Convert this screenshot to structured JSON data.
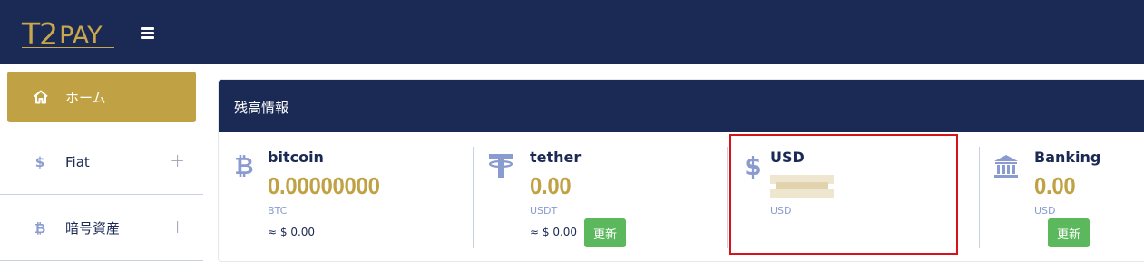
{
  "header": {
    "logo_t2": "T2",
    "logo_pay": "PAY",
    "menu_icon": "hamburger-menu-icon"
  },
  "sidebar": {
    "items": [
      {
        "label": "ホーム",
        "icon": "home-icon",
        "active": true
      },
      {
        "label": "Fiat",
        "icon": "dollar-icon",
        "expand": "+"
      },
      {
        "label": "暗号資産",
        "icon": "bitcoin-icon",
        "expand": "+"
      }
    ]
  },
  "panel": {
    "title": "残高情報",
    "cards": [
      {
        "name": "bitcoin",
        "icon": "bitcoin-icon",
        "value": "0.00000000",
        "unit": "BTC",
        "approx": "≈ $ 0.00"
      },
      {
        "name": "tether",
        "icon": "tether-icon",
        "value": "0.00",
        "unit": "USDT",
        "approx": "≈ $ 0.00",
        "button": "更新"
      },
      {
        "name": "USD",
        "icon": "dollar-icon",
        "value": "",
        "unit": "USD",
        "value_obscured": true
      },
      {
        "name": "Banking",
        "icon": "bank-icon",
        "value": "0.00",
        "unit": "USD",
        "button": "更新"
      }
    ]
  },
  "colors": {
    "navy": "#1b2a55",
    "gold": "#c0a244",
    "icon_blue": "#8a9bcf",
    "button_green": "#5cb85c",
    "highlight_red": "#d6121a"
  }
}
